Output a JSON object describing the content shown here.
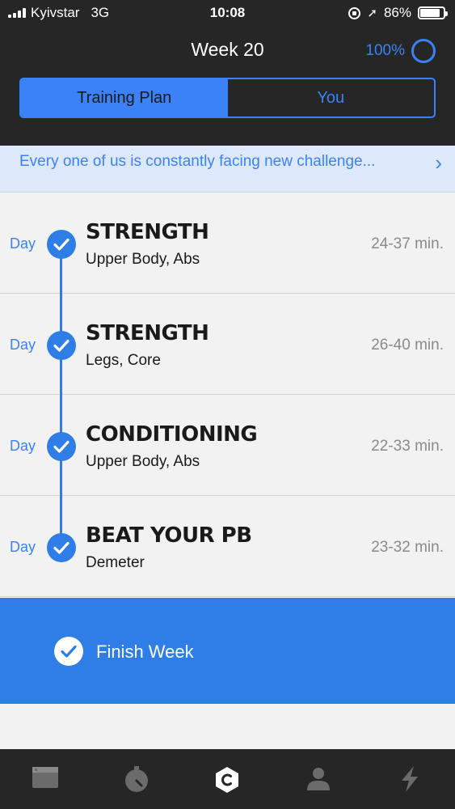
{
  "status_bar": {
    "carrier": "Kyivstar",
    "network": "3G",
    "time": "10:08",
    "battery": "86%",
    "battery_level": 0.86
  },
  "header": {
    "title": "Week 20",
    "progress": "100%",
    "tabs": [
      {
        "label": "Training Plan",
        "active": true
      },
      {
        "label": "You",
        "active": false
      }
    ]
  },
  "banner": {
    "text": "Every one of us is constantly facing new challenge..."
  },
  "days": [
    {
      "day_label": "Day",
      "title": "STRENGTH",
      "subtitle": "Upper Body, Abs",
      "duration": "24-37 min."
    },
    {
      "day_label": "Day",
      "title": "STRENGTH",
      "subtitle": "Legs, Core",
      "duration": "26-40 min."
    },
    {
      "day_label": "Day",
      "title": "CONDITIONING",
      "subtitle": "Upper Body, Abs",
      "duration": "22-33 min."
    },
    {
      "day_label": "Day",
      "title": "BEAT YOUR PB",
      "subtitle": "Demeter",
      "duration": "23-32 min."
    }
  ],
  "finish": {
    "label": "Finish Week"
  },
  "tabbar": {
    "items": [
      "browser-icon",
      "stopwatch-icon",
      "coach-hexagon-icon",
      "profile-icon",
      "lightning-icon"
    ]
  },
  "colors": {
    "accent": "#2f7ee8",
    "header_bg": "#262626",
    "banner_bg": "#dde9fb"
  }
}
